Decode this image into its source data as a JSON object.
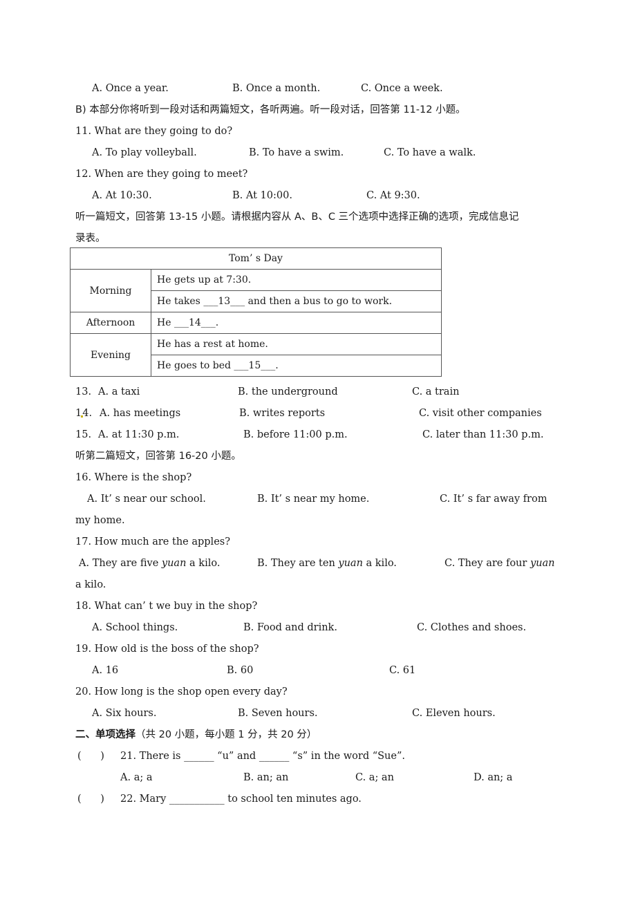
{
  "q10_options": {
    "a": "A. Once a year.",
    "b": "B. Once a month.",
    "c": "C. Once a week."
  },
  "sectionB_intro": "B) 本部分你将听到一段对话和两篇短文，各听两遍。听一段对话，回答第 11-12 小题。",
  "q11": {
    "stem": "11. What are they going to do?",
    "a": "A. To play volleyball.",
    "b": "B. To have a swim.",
    "c": "C. To have a walk."
  },
  "q12": {
    "stem": "12. When are they going to meet?",
    "a": "A. At 10:30.",
    "b": "B. At 10:00.",
    "c": "C. At 9:30."
  },
  "passage1_intro_line1": "听一篇短文，回答第 13-15 小题。请根据内容从 A、B、C 三个选项中选择正确的选项，完成信息记",
  "passage1_intro_line2": "录表。",
  "table": {
    "title": "Tom’ s Day",
    "rows": [
      {
        "period": "Morning",
        "items": [
          "He gets up at 7:30.",
          "He takes ___13___ and then a bus to go to work."
        ]
      },
      {
        "period": "Afternoon",
        "items": [
          "He ___14___."
        ]
      },
      {
        "period": "Evening",
        "items": [
          "He has a rest at home.",
          "He goes to bed ___15___."
        ]
      }
    ]
  },
  "q13": {
    "num": "13.",
    "a": "A. a taxi",
    "b": "B. the underground",
    "c": "C. a train"
  },
  "q14": {
    "num_pre": "1",
    "num_post": "4.",
    "a": "A. has meetings",
    "b": "B. writes reports",
    "c": "C. visit other companies"
  },
  "q15": {
    "num": "15.",
    "a": "A. at 11:30 p.m.",
    "b": "B. before 11:00 p.m.",
    "c": "C. later than 11:30 p.m."
  },
  "passage2_intro": "听第二篇短文，回答第 16-20 小题。",
  "q16": {
    "stem": "16. Where is the shop?",
    "a": "A. It’ s near our school.",
    "b": "B. It’ s near my home.",
    "c": "C. It’ s far away from",
    "c_cont": "my home."
  },
  "q17": {
    "stem": "17. How much are the apples?",
    "a_pre": "A. They are five ",
    "a_it": "yuan",
    "a_post": " a kilo.",
    "b_pre": "B. They are ten ",
    "b_it": "yuan",
    "b_post": " a kilo.",
    "c_pre": "C. They are four ",
    "c_it": "yuan",
    "c_cont": "a kilo."
  },
  "q18": {
    "stem": "18. What can’ t we buy in the shop?",
    "a": "A. School things.",
    "b": "B. Food and drink.",
    "c": "C. Clothes and shoes."
  },
  "q19": {
    "stem": "19. How old is the boss of the shop?",
    "a": "A. 16",
    "b": "B. 60",
    "c": "C. 61"
  },
  "q20": {
    "stem": "20. How long is the shop open every day?",
    "a": "A. Six hours.",
    "b": "B. Seven hours.",
    "c": "C. Eleven hours."
  },
  "section2": {
    "title_bold": "二、单项选择",
    "title_rest": "（共 20 小题，每小题 1 分，共 20 分）"
  },
  "q21": {
    "paren": "(      )",
    "stem": "21. There is ______ “u” and ______ “s” in the word “Sue”.",
    "a": "A. a; a",
    "b": "B. an; an",
    "c": "C. a; an",
    "d": "D. an; a"
  },
  "q22": {
    "paren": "(      )",
    "stem": "22. Mary ___________ to school ten minutes ago."
  }
}
